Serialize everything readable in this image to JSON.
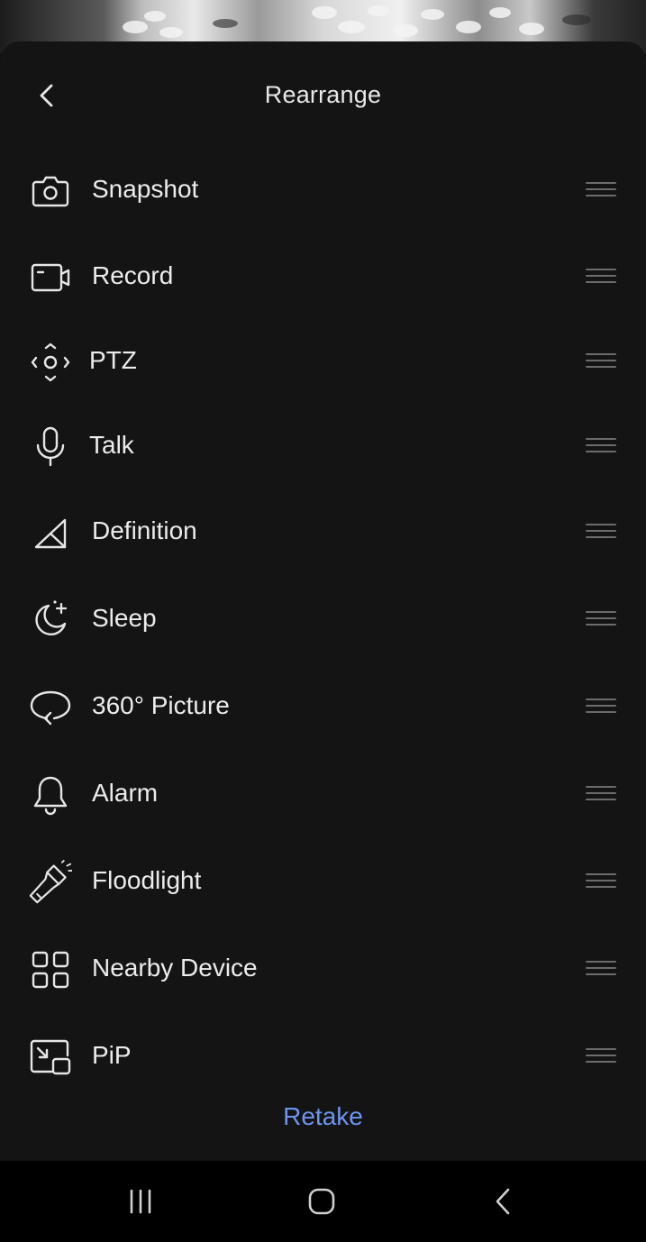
{
  "header": {
    "title": "Rearrange"
  },
  "items": [
    {
      "label": "Snapshot",
      "icon": "camera-icon"
    },
    {
      "label": "Record",
      "icon": "video-camera-icon"
    },
    {
      "label": "PTZ",
      "icon": "ptz-icon"
    },
    {
      "label": "Talk",
      "icon": "microphone-icon"
    },
    {
      "label": "Definition",
      "icon": "definition-icon"
    },
    {
      "label": "Sleep",
      "icon": "moon-star-icon"
    },
    {
      "label": "360° Picture",
      "icon": "rotate-360-icon"
    },
    {
      "label": "Alarm",
      "icon": "bell-icon"
    },
    {
      "label": "Floodlight",
      "icon": "flashlight-icon"
    },
    {
      "label": "Nearby Device",
      "icon": "grid-icon"
    },
    {
      "label": "PiP",
      "icon": "picture-in-picture-icon"
    }
  ],
  "footer": {
    "retake_label": "Retake"
  },
  "colors": {
    "sheet_background": "#141414",
    "text": "#ececec",
    "accent": "#6e95ee",
    "handle": "#6c6c6c",
    "navbar": "#000000"
  },
  "navbar": {
    "buttons": [
      "recent-apps-icon",
      "home-icon",
      "back-icon"
    ]
  }
}
